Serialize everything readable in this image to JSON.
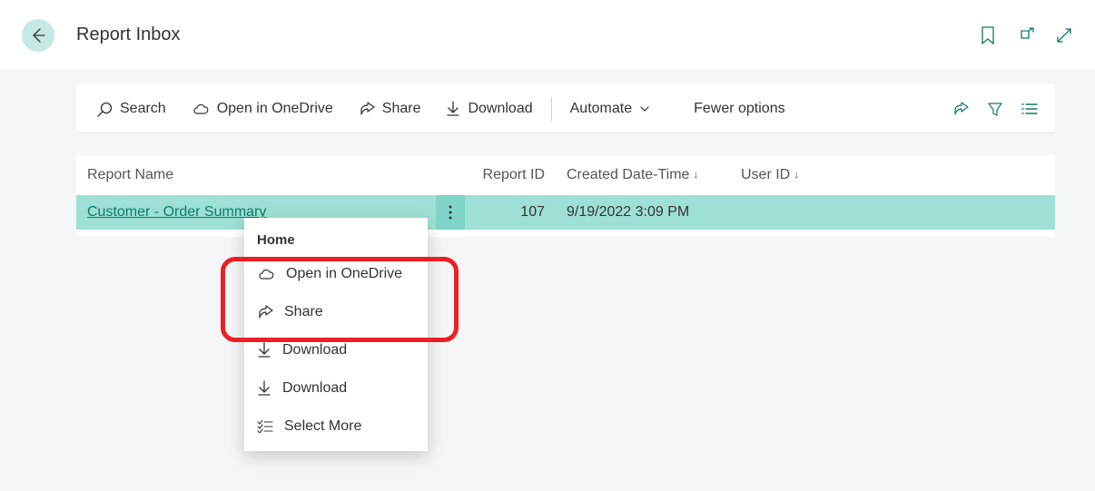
{
  "header": {
    "title": "Report Inbox"
  },
  "toolbar": {
    "search": "Search",
    "onedrive": "Open in OneDrive",
    "share": "Share",
    "download": "Download",
    "automate": "Automate",
    "fewer": "Fewer options"
  },
  "table": {
    "columns": {
      "name": "Report Name",
      "id": "Report ID",
      "date": "Created Date-Time",
      "user": "User ID"
    },
    "rows": [
      {
        "name": "Customer - Order Summary",
        "id": "107",
        "date": "9/19/2022 3:09 PM",
        "user": ""
      }
    ]
  },
  "contextMenu": {
    "header": "Home",
    "items": {
      "onedrive": "Open in OneDrive",
      "share": "Share",
      "download1": "Download",
      "download2": "Download",
      "selectmore": "Select More"
    }
  }
}
